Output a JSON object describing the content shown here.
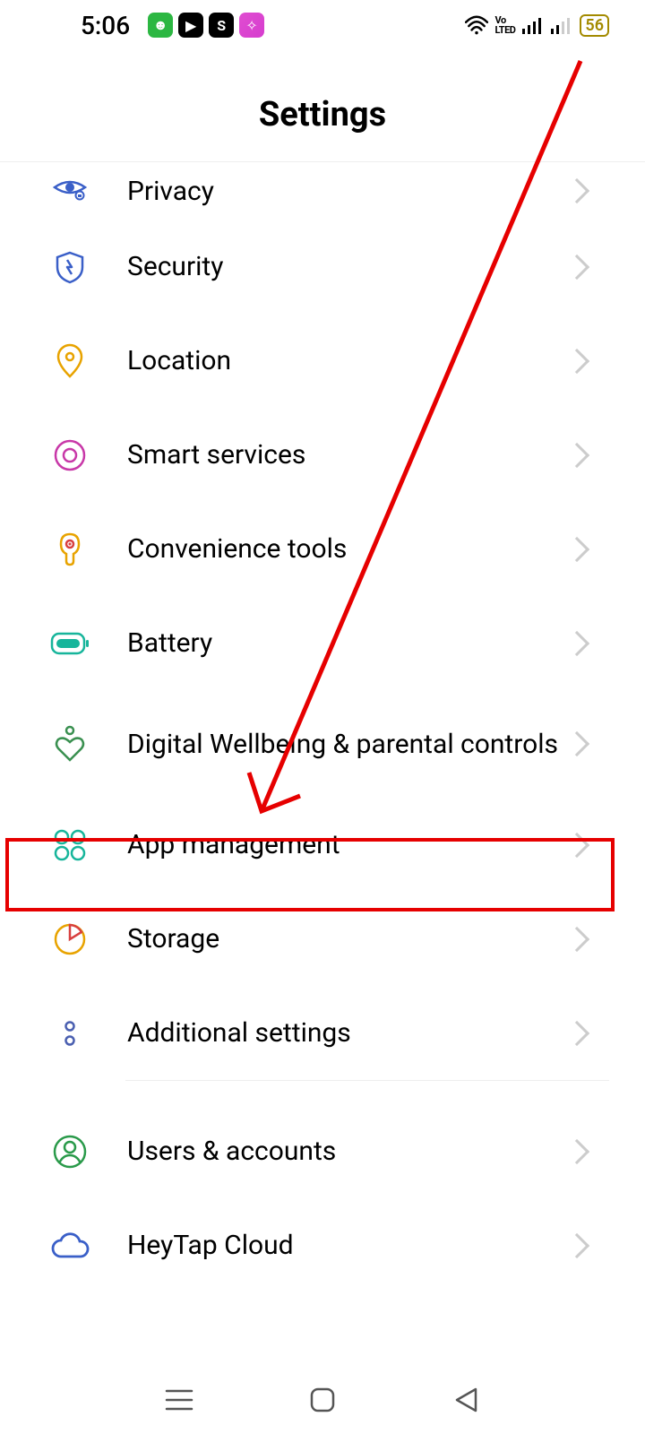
{
  "status": {
    "time": "5:06",
    "battery": "56"
  },
  "header": {
    "title": "Settings"
  },
  "rows": [
    {
      "label": "Privacy"
    },
    {
      "label": "Security"
    },
    {
      "label": "Location"
    },
    {
      "label": "Smart services"
    },
    {
      "label": "Convenience tools"
    },
    {
      "label": "Battery"
    },
    {
      "label": "Digital Wellbeing & parental controls"
    },
    {
      "label": "App management"
    },
    {
      "label": "Storage"
    },
    {
      "label": "Additional settings"
    },
    {
      "label": "Users & accounts"
    },
    {
      "label": "HeyTap Cloud"
    }
  ],
  "annotation": {
    "highlighted_row": "App management",
    "arrow_from": "status-bar-right",
    "arrow_to": "App management"
  }
}
